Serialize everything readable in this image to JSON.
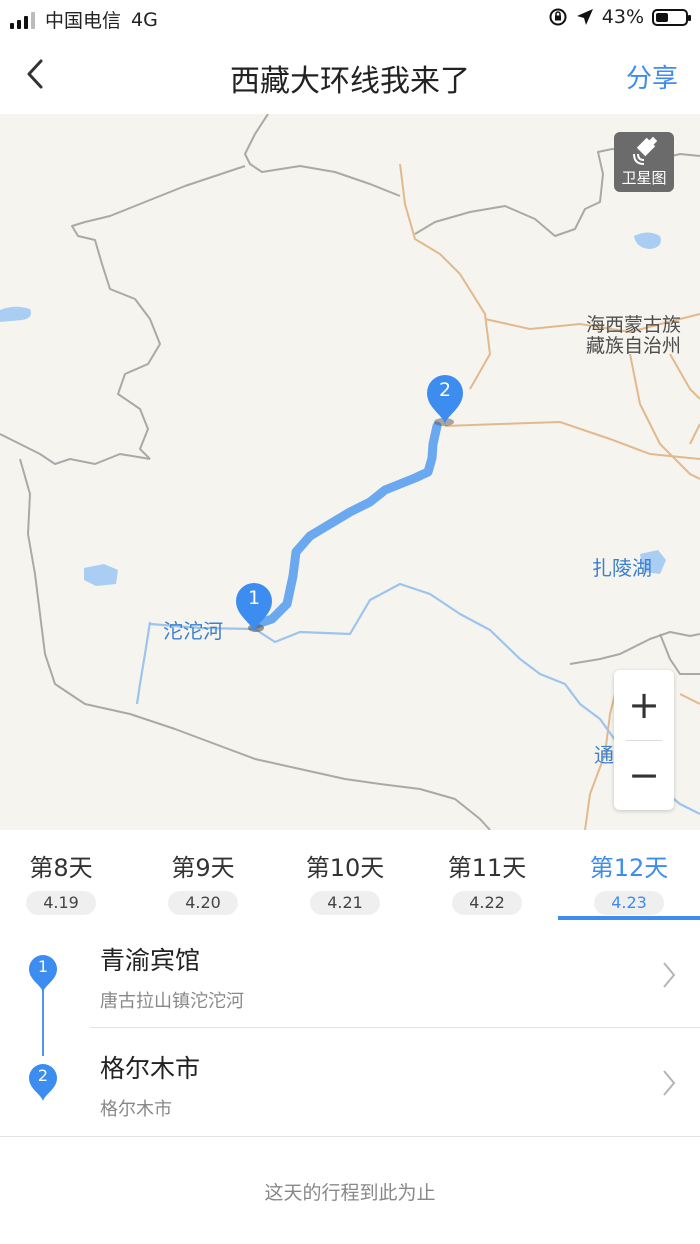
{
  "status_bar": {
    "carrier": "中国电信",
    "network": "4G",
    "battery": "43%",
    "battery_level": 0.43
  },
  "header": {
    "back_icon": "chevron-left-icon",
    "title": "西藏大环线我来了",
    "share_label": "分享"
  },
  "map": {
    "satellite_label": "卫星图",
    "labels": {
      "haixi_line1": "海西蒙古族",
      "haixi_line2": "藏族自治州",
      "zhaling": "扎陵湖",
      "tuotuohe": "沱沱河",
      "tong": "通"
    },
    "pins": [
      "1",
      "2"
    ],
    "zoom_in": "+",
    "zoom_out": "−"
  },
  "day_tabs": [
    {
      "label": "第8天",
      "date": "4.19",
      "active": false
    },
    {
      "label": "第9天",
      "date": "4.20",
      "active": false
    },
    {
      "label": "第10天",
      "date": "4.21",
      "active": false
    },
    {
      "label": "第11天",
      "date": "4.22",
      "active": false
    },
    {
      "label": "第12天",
      "date": "4.23",
      "active": true
    }
  ],
  "itinerary": [
    {
      "index": "1",
      "name": "青渝宾馆",
      "address": "唐古拉山镇沱沱河"
    },
    {
      "index": "2",
      "name": "格尔木市",
      "address": "格尔木市"
    }
  ],
  "end_note": "这天的行程到此为止",
  "colors": {
    "accent": "#3d8cf0",
    "route": "#6aa8f0",
    "river": "#9cc4ec",
    "border": "#a9a9a9",
    "road": "#e2b98e",
    "map_bg": "#f6f4ee"
  }
}
